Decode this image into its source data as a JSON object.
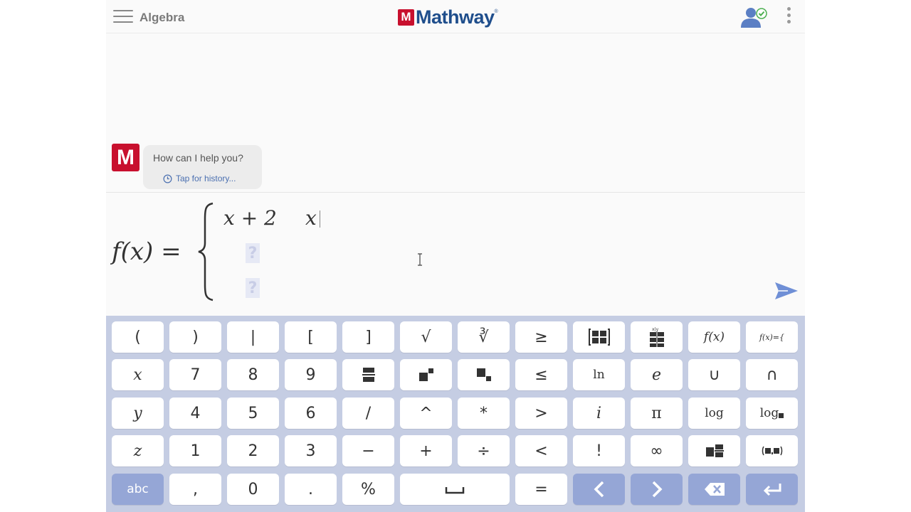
{
  "header": {
    "section_title": "Algebra",
    "brand_letter": "M",
    "brand_name": "Mathway",
    "brand_tm": "®"
  },
  "chat": {
    "avatar_letter": "M",
    "greeting": "How can I help you?",
    "history_link": "Tap for history..."
  },
  "editor": {
    "lhs": "f(x) =",
    "case1_expr": "x + 2",
    "case1_cond": "x",
    "placeholder": "?"
  },
  "keyboard": {
    "row1": [
      "(",
      ")",
      "|",
      "[",
      "]",
      "√",
      "∛",
      "≥",
      "matrix",
      "grid",
      "f(x)",
      "f(x)={"
    ],
    "row2": [
      "x",
      "7",
      "8",
      "9",
      "fraction",
      "superscript",
      "subscript",
      "≤",
      "ln",
      "e",
      "∪",
      "∩"
    ],
    "row3": [
      "y",
      "4",
      "5",
      "6",
      "/",
      "^",
      "*",
      ">",
      "i",
      "π",
      "log",
      "log■"
    ],
    "row4": [
      "z",
      "1",
      "2",
      "3",
      "−",
      "+",
      "÷",
      "<",
      "!",
      "∞",
      "mixed",
      "interval"
    ],
    "row5": [
      "abc",
      ",",
      "0",
      ".",
      "%",
      "space",
      "=",
      "left",
      "right",
      "backspace",
      "enter"
    ]
  },
  "labels": {
    "f_of_x": "f(x)",
    "f_of_x_piece": "f(x)={",
    "ln": "ln",
    "log": "log",
    "log_sub": "log",
    "abc": "abc"
  },
  "colors": {
    "brand_red": "#c8102e",
    "brand_blue": "#1f4e8c",
    "keyboard_bg": "#c5cde3",
    "dark_key": "#95a6d6",
    "send_blue": "#6f8fd6"
  }
}
